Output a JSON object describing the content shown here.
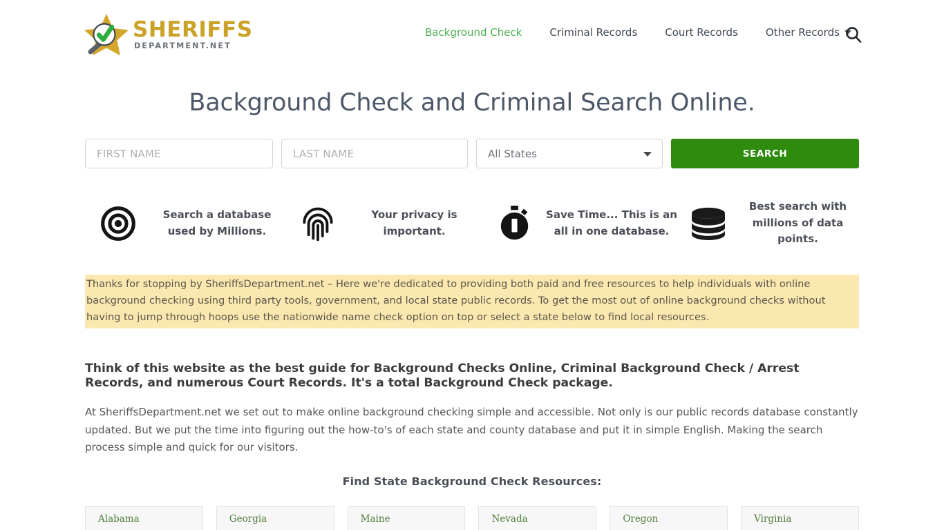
{
  "header": {
    "logo": {
      "title": "SHERIFFS",
      "subtitle": "DEPARTMENT.NET",
      "icon": "star-magnifier-check-logo"
    },
    "nav": [
      {
        "label": "Background Check",
        "active": true
      },
      {
        "label": "Criminal Records",
        "active": false
      },
      {
        "label": "Court Records",
        "active": false
      },
      {
        "label": "Other Records",
        "active": false,
        "has_dropdown": true
      }
    ],
    "search_icon": "search-icon"
  },
  "hero": {
    "title": "Background Check and Criminal Search Online."
  },
  "search_form": {
    "first_name": {
      "placeholder": "FIRST NAME",
      "value": ""
    },
    "last_name": {
      "placeholder": "LAST NAME",
      "value": ""
    },
    "state_select": {
      "selected": "All States",
      "options": [
        "All States",
        "Alabama",
        "Georgia",
        "Maine",
        "Nevada",
        "Oregon",
        "Virginia"
      ]
    },
    "submit_label": "SEARCH",
    "submit_color": "#2e8b0e"
  },
  "features": [
    {
      "icon": "target-icon",
      "text": "Search a database used by Millions."
    },
    {
      "icon": "fingerprint-icon",
      "text": "Your privacy is important."
    },
    {
      "icon": "stopwatch-icon",
      "text": "Save Time... This is an all in one database."
    },
    {
      "icon": "database-icon",
      "text": "Best search with millions of data points."
    }
  ],
  "notice": {
    "background": "#fbe8b0",
    "text": "Thanks for stopping by SheriffsDepartment.net – Here we're dedicated to providing both paid and free resources to help individuals with online background checking using third party tools, government, and local state public records. To get the most out of online background checks without having to jump through hoops use the nationwide name check option on top or select a state below to find local resources."
  },
  "content": {
    "lead": "Think of this website as the best guide for Background Checks Online, Criminal Background Check / Arrest Records, and numerous Court Records. It's a total Background Check package.",
    "paragraph": "At SheriffsDepartment.net we set out to make online background checking simple and accessible. Not only is our public records database constantly updated. But we put the time into figuring out the how-to's of each state and county database and put it in simple English. Making the search process simple and quick for our visitors."
  },
  "states_section": {
    "heading": "Find State Background Check Resources:",
    "cards": [
      {
        "label": "Alabama"
      },
      {
        "label": "Georgia"
      },
      {
        "label": "Maine"
      },
      {
        "label": "Nevada"
      },
      {
        "label": "Oregon"
      },
      {
        "label": "Virginia"
      }
    ]
  },
  "colors": {
    "accent_green": "#4caf50",
    "button_green": "#2e8b0e",
    "logo_gold": "#c9a227",
    "notice_yellow": "#fbe8b0",
    "heading_slate": "#4c5868",
    "state_link_green": "#4e7c3a"
  }
}
